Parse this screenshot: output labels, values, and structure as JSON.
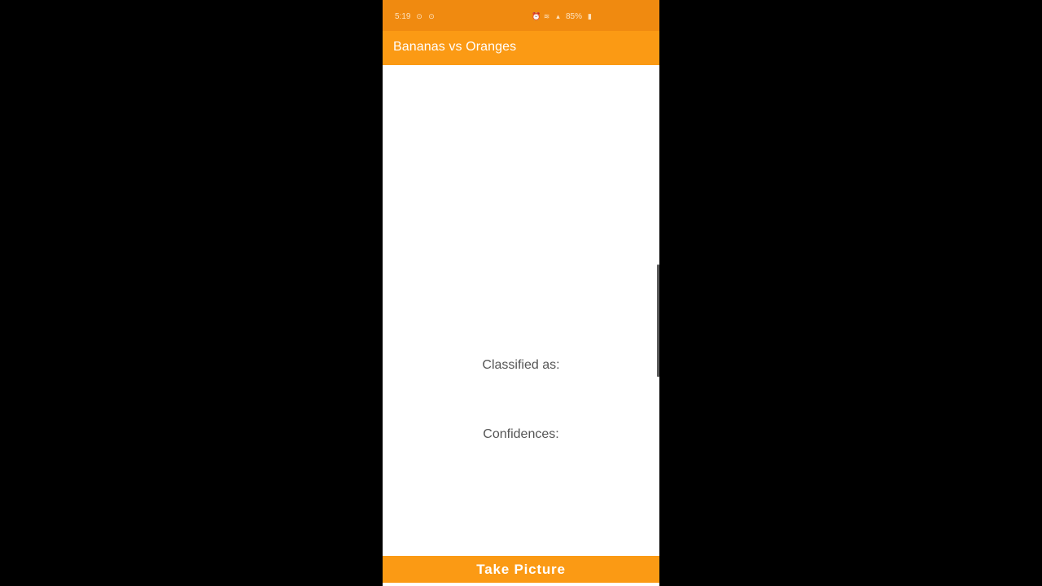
{
  "status_bar": {
    "time": "5:19",
    "battery": "85%",
    "icons": [
      "notification-icon",
      "notification-icon",
      "alarm-icon",
      "wifi-icon",
      "signal-icon",
      "battery-icon"
    ]
  },
  "app_bar": {
    "title": "Bananas vs Oranges"
  },
  "main": {
    "classified_label": "Classified as:",
    "confidences_label": "Confidences:"
  },
  "actions": {
    "take_picture_label": "Take Picture"
  },
  "colors": {
    "status_bar": "#f08a10",
    "accent": "#fb9a14",
    "background": "#ffffff",
    "text": "#555555"
  }
}
